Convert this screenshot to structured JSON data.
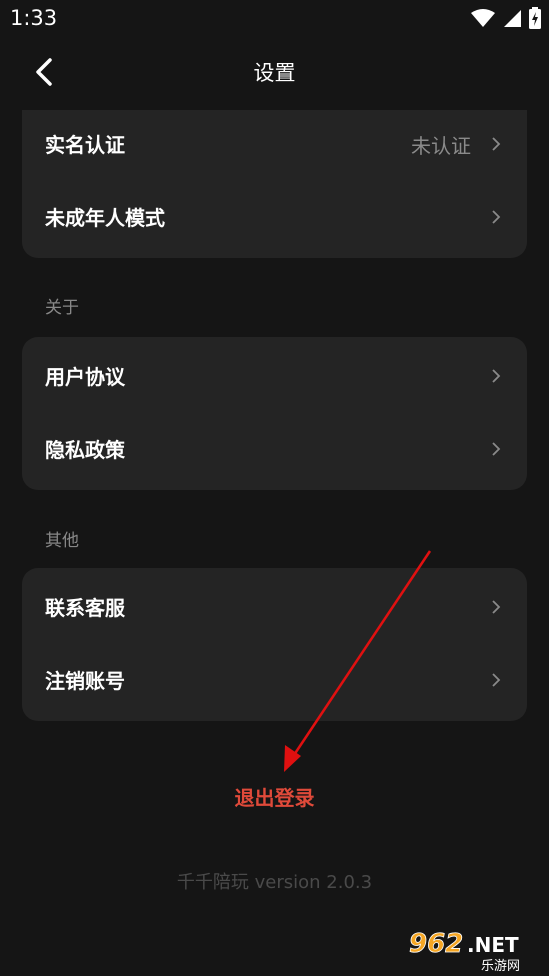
{
  "status_bar": {
    "time": "1:33"
  },
  "header": {
    "title": "设置"
  },
  "account_card": {
    "items": [
      {
        "label": "实名认证",
        "value": "未认证"
      },
      {
        "label": "未成年人模式"
      }
    ]
  },
  "about_section": {
    "title": "关于",
    "items": [
      {
        "label": "用户协议"
      },
      {
        "label": "隐私政策"
      }
    ]
  },
  "other_section": {
    "title": "其他",
    "items": [
      {
        "label": "联系客服"
      },
      {
        "label": "注销账号"
      }
    ]
  },
  "logout": {
    "label": "退出登录",
    "color": "#e04a3a"
  },
  "version": {
    "text": "千千陪玩 version 2.0.3"
  },
  "watermark": {
    "main": "962.NET",
    "sub": "乐游网"
  },
  "colors": {
    "background": "#151515",
    "card": "#242424",
    "annotation_arrow": "#e01010"
  }
}
